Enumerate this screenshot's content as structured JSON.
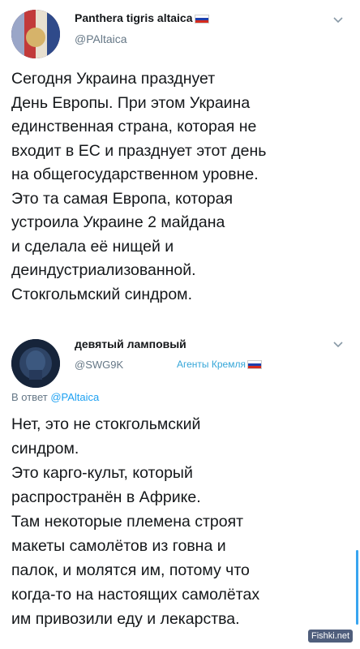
{
  "tweet1": {
    "author_name": "Panthera tigris altaica",
    "author_handle": "@PAltaica",
    "text": "Сегодня Украина празднует\nДень Европы. При этом Украина\nединственная страна, которая не\nвходит в ЕС и празднует этот день\nна общегосударственном уровне.\nЭто та самая Европа, которая\nустроила Украине 2 майдана\nи сделала её нищей и\nдеиндустриализованной.\nСтокгольмский синдром."
  },
  "tweet2": {
    "author_name": "девятый ламповый",
    "author_handle": "@SWG9K",
    "tag": "Агенты Кремля",
    "reply_prefix": "В ответ",
    "reply_mention": "@PAltaica",
    "text": "Нет, это не стокгольмский\nсиндром.\nЭто карго-культ, который\nраспространён в Африке.\nТам некоторые племена строят\nмакеты самолётов из говна и\nпалок, и молятся им, потому что\nкогда-то на настоящих самолётах\nим привозили еду и лекарства."
  },
  "watermark": "Fishki.net",
  "colors": {
    "accent": "#1da1f2",
    "secondary_text": "#657786",
    "tag": "#35a6d8"
  }
}
